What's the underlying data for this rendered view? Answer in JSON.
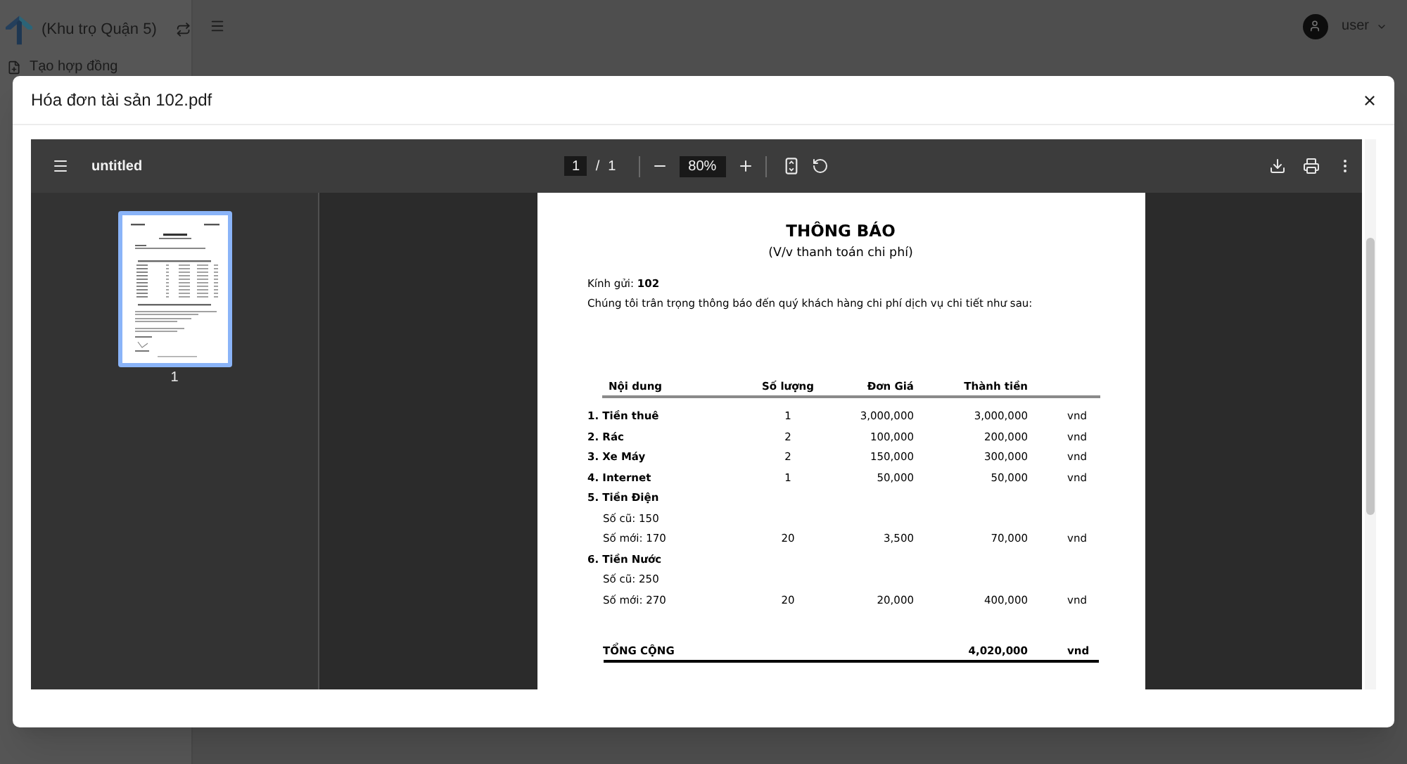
{
  "app": {
    "sidebar": {
      "workspace": "(Khu trọ Quận 5)",
      "items": [
        {
          "label": "Tạo hợp đồng"
        }
      ]
    },
    "header": {
      "user": "user"
    }
  },
  "modal": {
    "title": "Hóa đơn tài sản 102.pdf"
  },
  "viewer": {
    "file_name": "untitled",
    "page": "1",
    "page_separator": "/",
    "page_count": "1",
    "zoom": "80%",
    "thumbnails": [
      {
        "label": "1",
        "selected": true
      }
    ]
  },
  "document": {
    "title": "THÔNG BÁO",
    "subtitle": "(V/v thanh toán chi phí)",
    "recipient": "Kính gửi: **102**",
    "intro": "Chúng tôi trân trọng thông báo đến quý khách hàng chi phí dịch vụ chi tiết như sau:",
    "table": {
      "columns": [
        "Nội dung",
        "Số lượng",
        "Đơn Giá",
        "Thành tiền"
      ],
      "rows": [
        {
          "kind": "item",
          "name": "1. Tiền thuê",
          "quantity": "1",
          "unit_price": "3,000,000",
          "amount": "3,000,000",
          "unit": "vnd"
        },
        {
          "kind": "item",
          "name": "2. Rác",
          "quantity": "2",
          "unit_price": "100,000",
          "amount": "200,000",
          "unit": "vnd"
        },
        {
          "kind": "item",
          "name": "3. Xe Máy",
          "quantity": "2",
          "unit_price": "150,000",
          "amount": "300,000",
          "unit": "vnd"
        },
        {
          "kind": "item",
          "name": "4. Internet",
          "quantity": "1",
          "unit_price": "50,000",
          "amount": "50,000",
          "unit": "vnd"
        },
        {
          "kind": "item",
          "name": "5. Tiền Điện"
        },
        {
          "kind": "reading",
          "name": "Số cũ: 150"
        },
        {
          "kind": "reading",
          "name": "Số mới: 170",
          "quantity": "20",
          "unit_price": "3,500",
          "amount": "70,000",
          "unit": "vnd"
        },
        {
          "kind": "item",
          "name": "6. Tiền Nước"
        },
        {
          "kind": "reading",
          "name": "Số cũ: 250"
        },
        {
          "kind": "reading",
          "name": "Số mới: 270",
          "quantity": "20",
          "unit_price": "20,000",
          "amount": "400,000",
          "unit": "vnd"
        }
      ],
      "total": {
        "label": "TỔNG CỘNG",
        "amount": "4,020,000",
        "unit": "vnd"
      }
    }
  }
}
